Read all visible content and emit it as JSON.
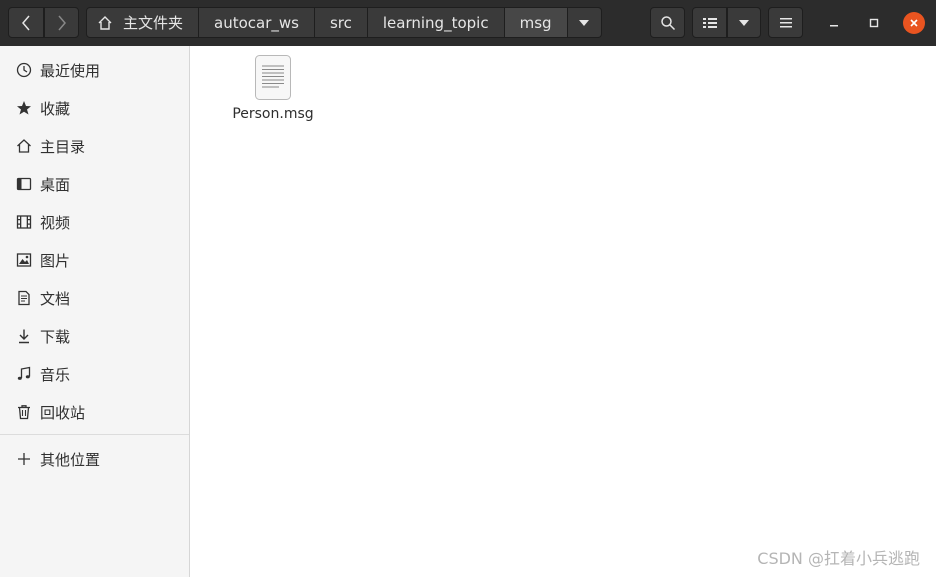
{
  "breadcrumb": [
    "主文件夹",
    "autocar_ws",
    "src",
    "learning_topic",
    "msg"
  ],
  "sidebar": {
    "items": [
      {
        "label": "最近使用",
        "icon": "clock-icon"
      },
      {
        "label": "收藏",
        "icon": "star-icon"
      },
      {
        "label": "主目录",
        "icon": "home-icon"
      },
      {
        "label": "桌面",
        "icon": "desktop-icon"
      },
      {
        "label": "视频",
        "icon": "film-icon"
      },
      {
        "label": "图片",
        "icon": "image-icon"
      },
      {
        "label": "文档",
        "icon": "document-icon"
      },
      {
        "label": "下载",
        "icon": "download-icon"
      },
      {
        "label": "音乐",
        "icon": "music-icon"
      },
      {
        "label": "回收站",
        "icon": "trash-icon"
      }
    ],
    "other": {
      "label": "其他位置",
      "icon": "plus-icon"
    }
  },
  "files": [
    {
      "name": "Person.msg",
      "icon": "text-file-icon"
    }
  ],
  "watermark": "CSDN @扛着小兵逃跑",
  "colors": {
    "headerbar": "#2c2c2c",
    "button": "#3a3a3a",
    "sidebar": "#f5f5f5",
    "close_accent": "#e95420"
  }
}
